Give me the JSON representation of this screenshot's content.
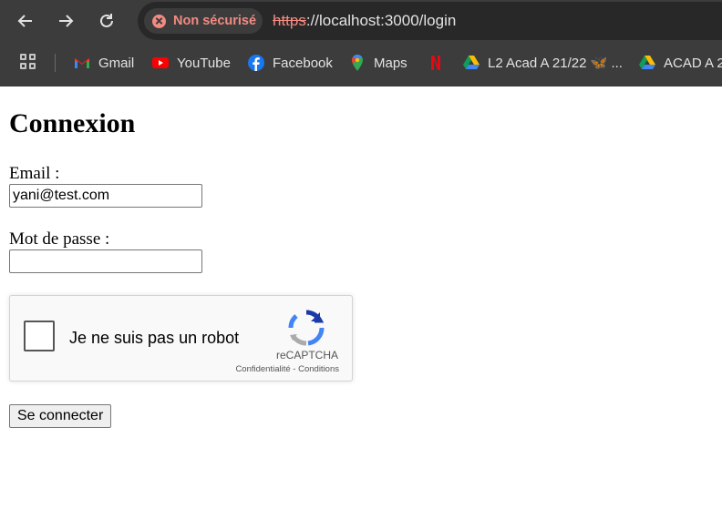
{
  "browser": {
    "security_label": "Non sécurisé",
    "url_scheme": "https",
    "url_rest": "://localhost:3000/login"
  },
  "bookmarks": [
    {
      "label": "Gmail",
      "icon": "gmail-icon"
    },
    {
      "label": "YouTube",
      "icon": "youtube-icon"
    },
    {
      "label": "Facebook",
      "icon": "facebook-icon"
    },
    {
      "label": "Maps",
      "icon": "maps-icon"
    },
    {
      "label": "",
      "icon": "netflix-icon"
    },
    {
      "label": "L2 Acad A 21/22 🦋 ...",
      "icon": "google-drive-icon"
    },
    {
      "label": "ACAD A 2",
      "icon": "google-drive-icon"
    }
  ],
  "page": {
    "title": "Connexion",
    "email_label": "Email :",
    "email_value": "yani@test.com",
    "password_label": "Mot de passe :",
    "password_value": "",
    "submit_label": "Se connecter"
  },
  "captcha": {
    "label": "Je ne suis pas un robot",
    "brand": "reCAPTCHA",
    "privacy": "Confidentialité",
    "separator": " - ",
    "terms": "Conditions"
  },
  "colors": {
    "toolbar": "#3c3c3c",
    "omnibox": "#282828",
    "warning": "#f28b82"
  }
}
